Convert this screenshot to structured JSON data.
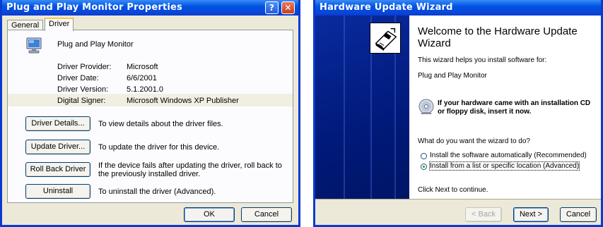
{
  "left_window": {
    "title": "Plug and Play Monitor Properties",
    "help_glyph": "?",
    "close_glyph": "✕",
    "tabs": [
      {
        "label": "General",
        "active": false
      },
      {
        "label": "Driver",
        "active": true
      }
    ],
    "device_name": "Plug and Play Monitor",
    "properties": [
      {
        "label": "Driver Provider:",
        "value": "Microsoft"
      },
      {
        "label": "Driver Date:",
        "value": "6/6/2001"
      },
      {
        "label": "Driver Version:",
        "value": "5.1.2001.0"
      },
      {
        "label": "Digital Signer:",
        "value": "Microsoft Windows XP Publisher"
      }
    ],
    "actions": [
      {
        "button": "Driver Details...",
        "description": "To view details about the driver files."
      },
      {
        "button": "Update Driver...",
        "description": "To update the driver for this device."
      },
      {
        "button": "Roll Back Driver",
        "description": "If the device fails after updating the driver, roll back to the previously installed driver."
      },
      {
        "button": "Uninstall",
        "description": "To uninstall the driver (Advanced)."
      }
    ],
    "ok_label": "OK",
    "cancel_label": "Cancel"
  },
  "right_window": {
    "title": "Hardware Update Wizard",
    "heading": "Welcome to the Hardware Update Wizard",
    "intro": "This wizard helps you install software for:",
    "device": "Plug and Play Monitor",
    "cd_prompt": "If your hardware came with an installation CD or floppy disk, insert it now.",
    "question": "What do you want the wizard to do?",
    "options": [
      {
        "label": "Install the software automatically (Recommended)",
        "selected": false
      },
      {
        "label": "Install from a list or specific location (Advanced)",
        "selected": true
      }
    ],
    "continue_text": "Click Next to continue.",
    "back_label": "< Back",
    "next_label": "Next >",
    "cancel_label": "Cancel"
  },
  "colors": {
    "titlebar": "#0054e3",
    "window_face": "#ece9d8",
    "wizard_side": "#001a7a",
    "active_tab_accent": "#ffc83c"
  }
}
